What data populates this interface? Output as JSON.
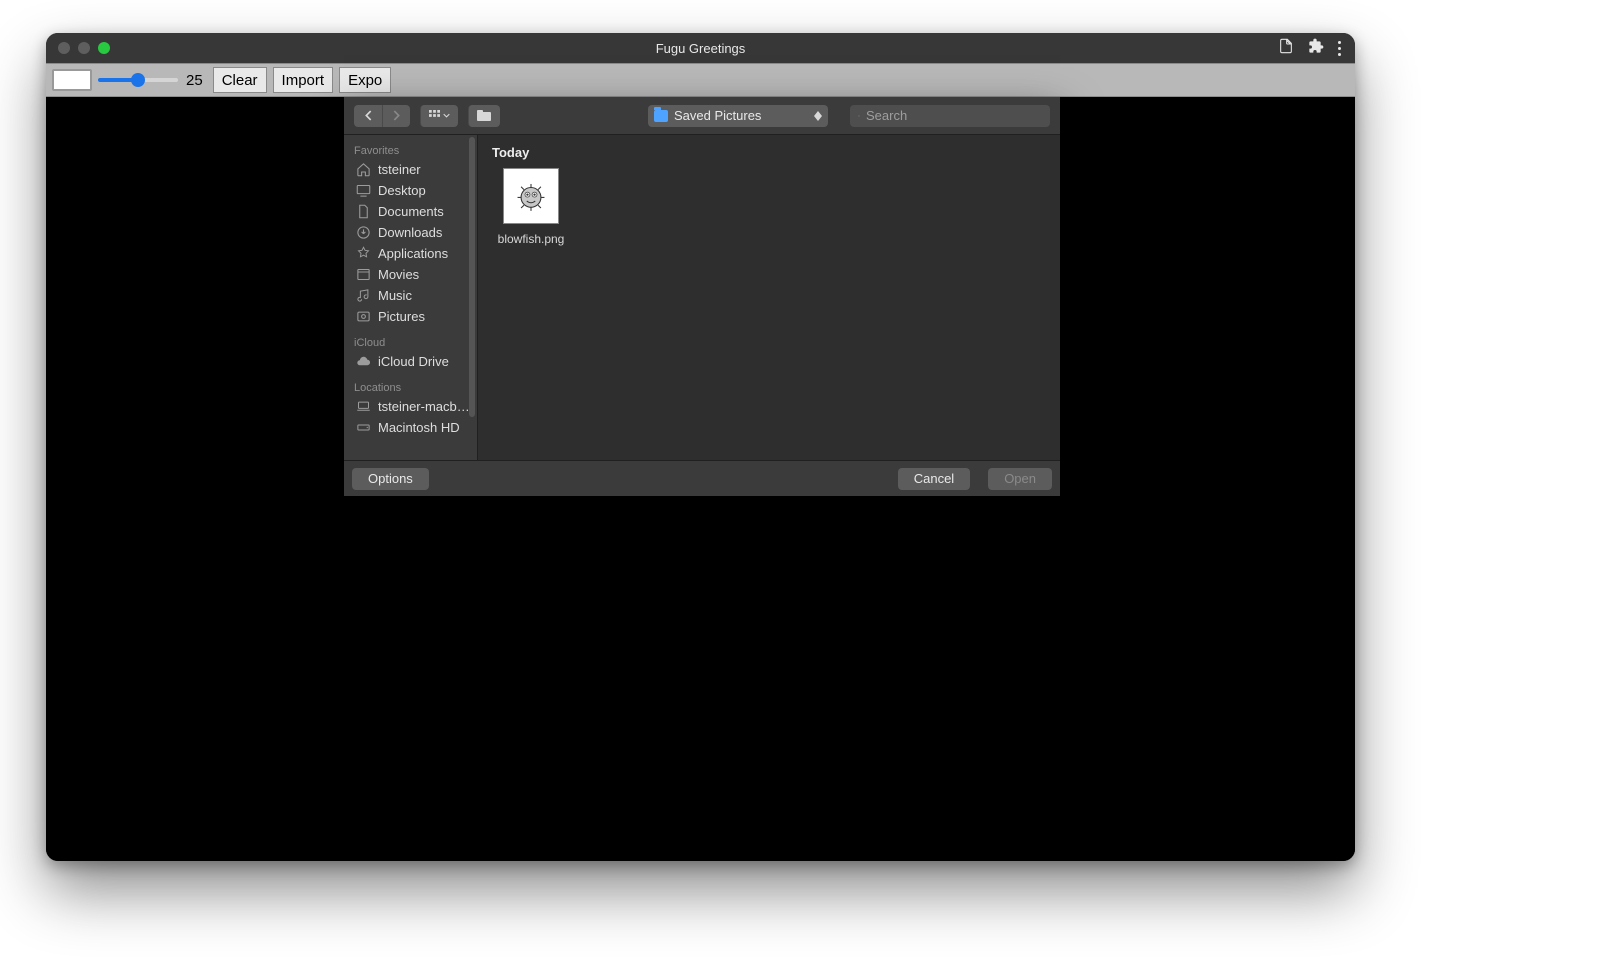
{
  "window": {
    "title": "Fugu Greetings"
  },
  "appToolbar": {
    "slider_value": "25",
    "buttons": {
      "clear": "Clear",
      "import": "Import",
      "export": "Expo"
    }
  },
  "dialog": {
    "path_label": "Saved Pictures",
    "search_placeholder": "Search",
    "sidebar": {
      "favorites_header": "Favorites",
      "favorites": [
        {
          "label": "tsteiner",
          "icon": "home"
        },
        {
          "label": "Desktop",
          "icon": "desktop"
        },
        {
          "label": "Documents",
          "icon": "doc"
        },
        {
          "label": "Downloads",
          "icon": "download"
        },
        {
          "label": "Applications",
          "icon": "apps"
        },
        {
          "label": "Movies",
          "icon": "movies"
        },
        {
          "label": "Music",
          "icon": "music"
        },
        {
          "label": "Pictures",
          "icon": "pictures"
        }
      ],
      "icloud_header": "iCloud",
      "icloud": [
        {
          "label": "iCloud Drive",
          "icon": "cloud"
        }
      ],
      "locations_header": "Locations",
      "locations": [
        {
          "label": "tsteiner-macb…",
          "icon": "laptop"
        },
        {
          "label": "Macintosh HD",
          "icon": "disk"
        }
      ]
    },
    "content": {
      "group_header": "Today",
      "files": [
        {
          "name": "blowfish.png"
        }
      ]
    },
    "footer": {
      "options": "Options",
      "cancel": "Cancel",
      "open": "Open"
    }
  }
}
